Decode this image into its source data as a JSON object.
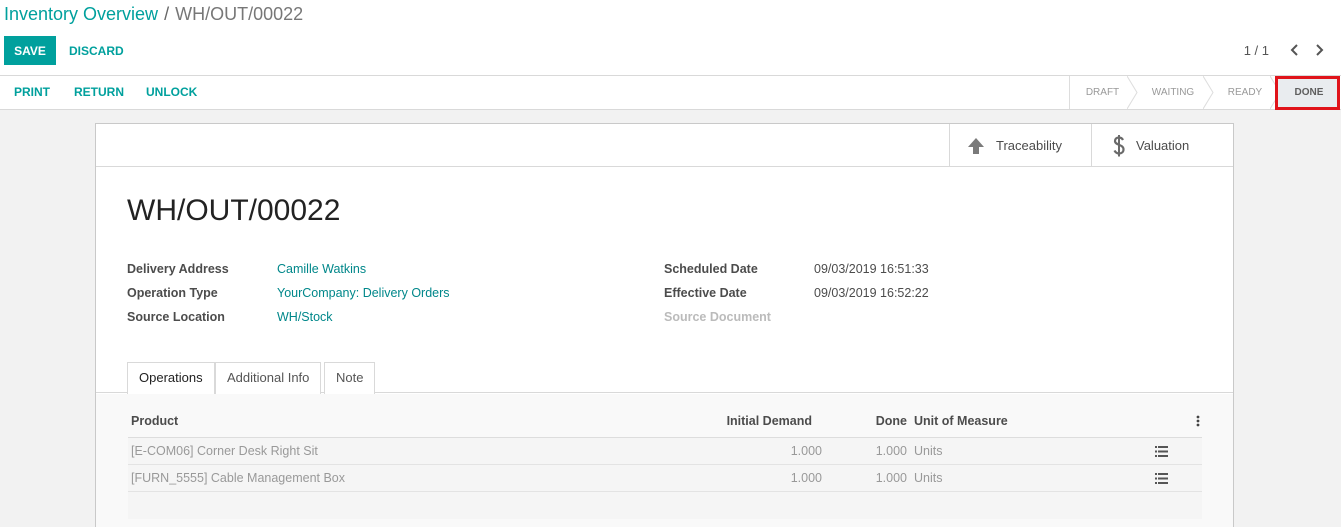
{
  "breadcrumb": {
    "parent": "Inventory Overview",
    "separator": "/",
    "current": "WH/OUT/00022"
  },
  "toolbar": {
    "save_label": "SAVE",
    "discard_label": "DISCARD"
  },
  "pager": {
    "value": "1 / 1",
    "prev_icon": "chevron-left-icon",
    "next_icon": "chevron-right-icon"
  },
  "header_actions": {
    "print_label": "PRINT",
    "return_label": "RETURN",
    "unlock_label": "UNLOCK"
  },
  "status": {
    "stages": [
      "DRAFT",
      "WAITING",
      "READY",
      "DONE"
    ],
    "current": "DONE",
    "highlight_color": "#e0131a"
  },
  "smart_buttons": {
    "traceability_label": "Traceability",
    "valuation_label": "Valuation"
  },
  "record": {
    "title": "WH/OUT/00022"
  },
  "fields": {
    "delivery_address_label": "Delivery Address",
    "delivery_address_value": "Camille Watkins",
    "operation_type_label": "Operation Type",
    "operation_type_value": "YourCompany: Delivery Orders",
    "source_location_label": "Source Location",
    "source_location_value": "WH/Stock",
    "scheduled_date_label": "Scheduled Date",
    "scheduled_date_value": "09/03/2019 16:51:33",
    "effective_date_label": "Effective Date",
    "effective_date_value": "09/03/2019 16:52:22",
    "source_document_label": "Source Document"
  },
  "tabs": {
    "operations": "Operations",
    "additional_info": "Additional Info",
    "note": "Note"
  },
  "operations_table": {
    "headers": {
      "product": "Product",
      "initial_demand": "Initial Demand",
      "done": "Done",
      "uom": "Unit of Measure"
    },
    "rows": [
      {
        "product": "[E-COM06] Corner Desk Right Sit",
        "initial_demand": "1.000",
        "done": "1.000",
        "uom": "Units"
      },
      {
        "product": "[FURN_5555] Cable Management Box",
        "initial_demand": "1.000",
        "done": "1.000",
        "uom": "Units"
      }
    ]
  },
  "colors": {
    "accent": "#00a09d",
    "link": "#00878a"
  }
}
